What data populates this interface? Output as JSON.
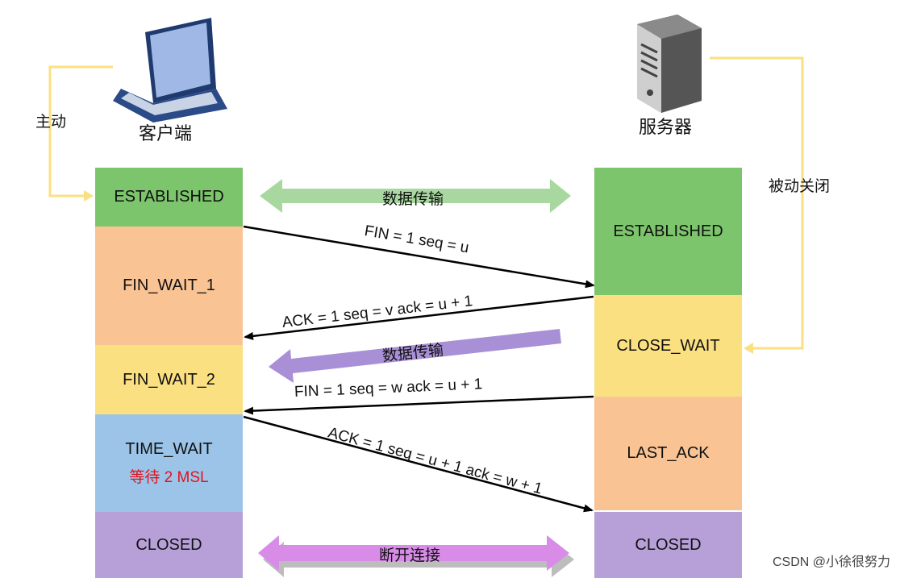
{
  "client": {
    "label": "客户端",
    "icon": "laptop-icon",
    "side_label": "主动",
    "states": [
      {
        "name": "ESTABLISHED",
        "color": "#7dc56c"
      },
      {
        "name": "FIN_WAIT_1",
        "color": "#f9c394"
      },
      {
        "name": "FIN_WAIT_2",
        "color": "#fbe082"
      },
      {
        "name": "TIME_WAIT",
        "color": "#9bc4e8",
        "note": "等待 2 MSL",
        "note_color": "#e0141e"
      },
      {
        "name": "CLOSED",
        "color": "#b7a0d8"
      }
    ]
  },
  "server": {
    "label": "服务器",
    "icon": "server-icon",
    "side_label": "被动关闭",
    "states": [
      {
        "name": "ESTABLISHED",
        "color": "#7dc56c"
      },
      {
        "name": "CLOSE_WAIT",
        "color": "#fbe082"
      },
      {
        "name": "LAST_ACK",
        "color": "#f9c394"
      },
      {
        "name": "CLOSED",
        "color": "#b7a0d8"
      }
    ]
  },
  "messages": [
    {
      "label": "FIN = 1 seq = u",
      "direction": "client-to-server"
    },
    {
      "label": "ACK = 1 seq = v ack = u + 1",
      "direction": "server-to-client"
    },
    {
      "label": "FIN = 1 seq = w ack = u + 1",
      "direction": "server-to-client"
    },
    {
      "label": "ACK = 1 seq = u + 1 ack = w + 1",
      "direction": "client-to-server"
    }
  ],
  "data_transfer": [
    {
      "label": "数据传输",
      "kind": "bidirectional",
      "color": "#a8d8a0"
    },
    {
      "label": "数据传输",
      "kind": "server-to-client",
      "color": "#a98fd6"
    }
  ],
  "disconnect": {
    "label": "断开连接",
    "color": "#d98be8"
  },
  "watermark": "CSDN @小徐很努力",
  "colors": {
    "yellow_arrow": "#fbe082",
    "line": "#000000"
  }
}
